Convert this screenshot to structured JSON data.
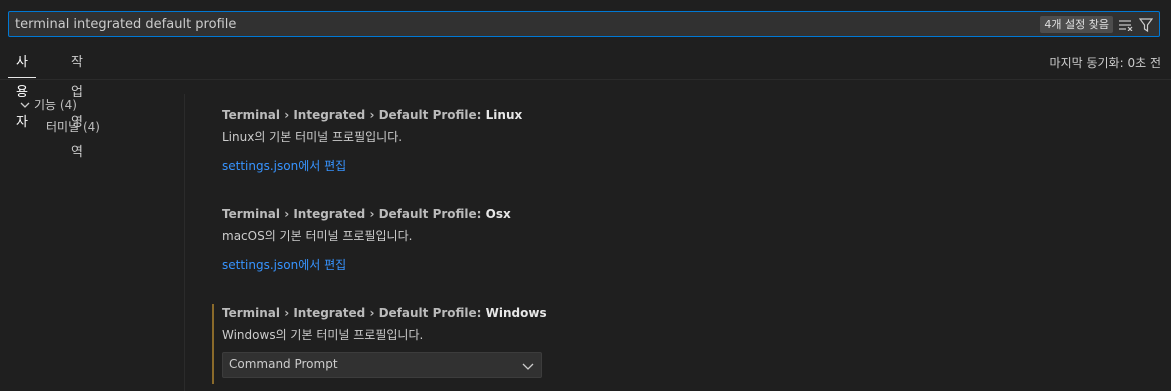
{
  "search": {
    "value": "terminal integrated default profile",
    "result_count": "4개 설정 찾음"
  },
  "tabs": [
    {
      "label": "사용자"
    },
    {
      "label": "작업 영역"
    }
  ],
  "last_sync": "마지막 동기화: 0초 전",
  "toc": {
    "features": {
      "label": "기능",
      "count": "(4)"
    },
    "terminal": {
      "label": "터미널",
      "count": "(4)"
    }
  },
  "settings": [
    {
      "category": "Terminal › Integrated › Default Profile: ",
      "key": "Linux",
      "description": "Linux의 기본 터미널 프로필입니다.",
      "link": "settings.json에서 편집"
    },
    {
      "category": "Terminal › Integrated › Default Profile: ",
      "key": "Osx",
      "description": "macOS의 기본 터미널 프로필입니다.",
      "link": "settings.json에서 편집"
    },
    {
      "category": "Terminal › Integrated › Default Profile: ",
      "key": "Windows",
      "description": "Windows의 기본 터미널 프로필입니다.",
      "select_value": "Command Prompt"
    }
  ],
  "colors": {
    "accent": "#0078d4",
    "link": "#3794ff",
    "modified_indicator": "#8a6a2a"
  }
}
